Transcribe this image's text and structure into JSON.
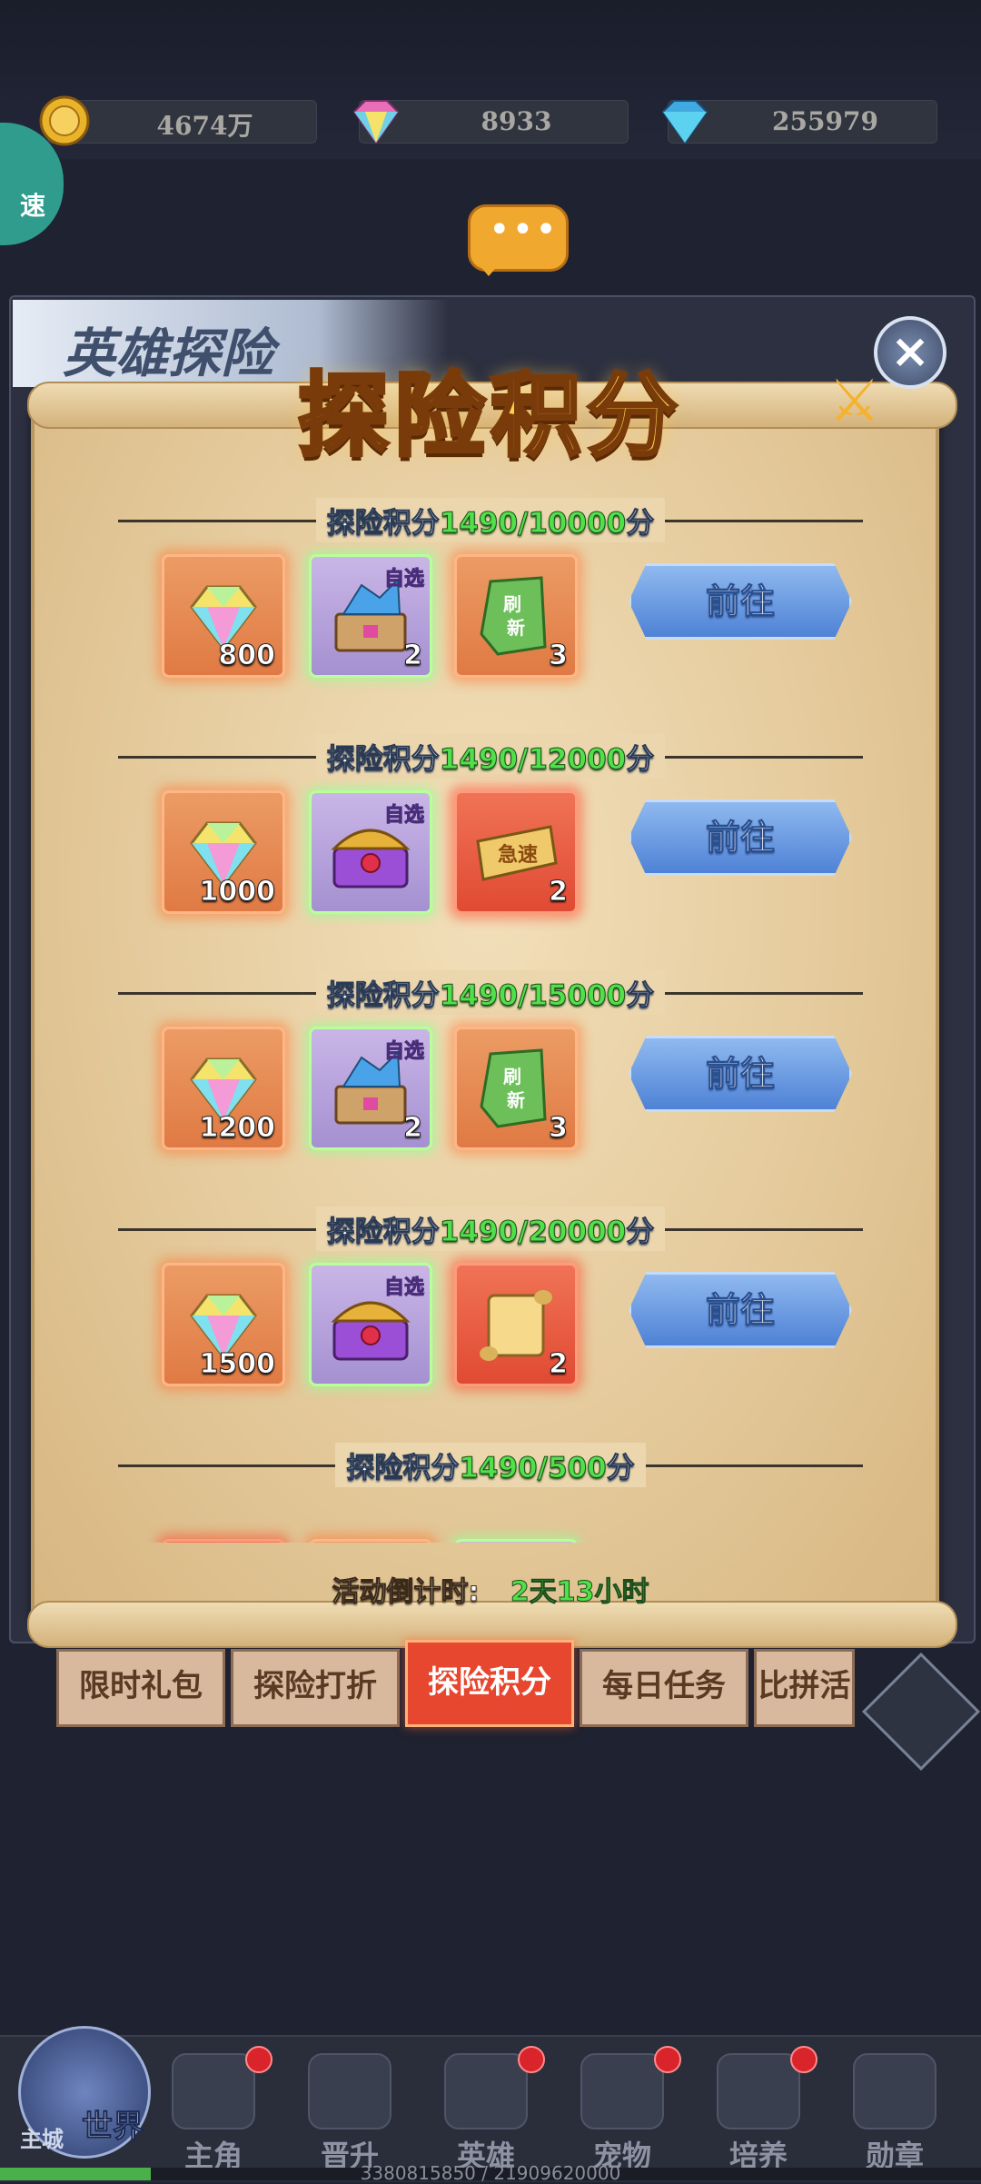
{
  "currencies": [
    {
      "icon": "gold-coin-icon",
      "value": "4674万"
    },
    {
      "icon": "rainbow-gem-icon",
      "value": "8933"
    },
    {
      "icon": "blue-diamond-icon",
      "value": "255979"
    }
  ],
  "speed_label": "速",
  "background_title": "英雄探险",
  "panel_title": "探险积分",
  "milestones": [
    {
      "label": "探险积分",
      "progress": "1490/10000",
      "unit": "分",
      "rewards": [
        {
          "icon": "gem-icon",
          "qty": "800",
          "tag": "",
          "style": "orange"
        },
        {
          "icon": "select-chest-icon",
          "qty": "2",
          "tag": "自选",
          "style": "purple"
        },
        {
          "icon": "refresh-ticket-icon",
          "qty": "3",
          "tag": "",
          "style": "orange"
        }
      ],
      "button": "前往"
    },
    {
      "label": "探险积分",
      "progress": "1490/12000",
      "unit": "分",
      "rewards": [
        {
          "icon": "gem-icon",
          "qty": "1000",
          "tag": "",
          "style": "orange"
        },
        {
          "icon": "treasure-chest-icon",
          "qty": "",
          "tag": "自选",
          "style": "purple"
        },
        {
          "icon": "speedup-ticket-icon",
          "qty": "2",
          "tag": "",
          "style": "red"
        }
      ],
      "button": "前往"
    },
    {
      "label": "探险积分",
      "progress": "1490/15000",
      "unit": "分",
      "rewards": [
        {
          "icon": "gem-icon",
          "qty": "1200",
          "tag": "",
          "style": "orange"
        },
        {
          "icon": "select-chest-icon",
          "qty": "2",
          "tag": "自选",
          "style": "purple"
        },
        {
          "icon": "refresh-ticket-icon",
          "qty": "3",
          "tag": "",
          "style": "orange"
        }
      ],
      "button": "前往"
    },
    {
      "label": "探险积分",
      "progress": "1490/20000",
      "unit": "分",
      "rewards": [
        {
          "icon": "gem-icon",
          "qty": "1500",
          "tag": "",
          "style": "orange"
        },
        {
          "icon": "treasure-chest-icon",
          "qty": "",
          "tag": "自选",
          "style": "purple"
        },
        {
          "icon": "scroll-icon",
          "qty": "2",
          "tag": "",
          "style": "red"
        }
      ],
      "button": "前往"
    },
    {
      "label": "探险积分",
      "progress": "1490/500",
      "unit": "分",
      "rewards": [],
      "button": ""
    }
  ],
  "ticket_texts": {
    "refresh": "刷新",
    "speedup": "急速"
  },
  "countdown": {
    "label": "活动倒计时:",
    "value": "2天13小时"
  },
  "tabs": [
    "限时礼包",
    "探险打折",
    "探险积分",
    "每日任务",
    "比拼活"
  ],
  "active_tab": 2,
  "nav": {
    "world": {
      "label": "世界",
      "sub": "主城"
    },
    "items": [
      {
        "label": "主角",
        "badge": true
      },
      {
        "label": "晋升",
        "badge": false
      },
      {
        "label": "英雄",
        "badge": true
      },
      {
        "label": "宠物",
        "badge": true
      },
      {
        "label": "培养",
        "badge": true
      },
      {
        "label": "勋章",
        "badge": false
      }
    ]
  },
  "xp": {
    "text": "3380815850 / 21909620000",
    "fraction": 0.154
  }
}
